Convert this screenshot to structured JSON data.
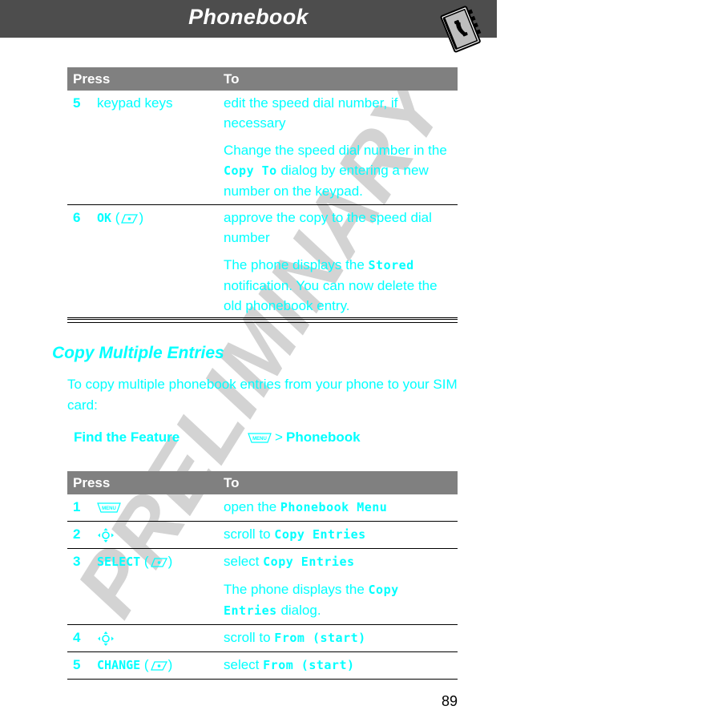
{
  "header": {
    "title": "Phonebook",
    "icon": "phonebook-icon"
  },
  "watermark": "PRELIMINARY",
  "table1": {
    "headers": {
      "press": "Press",
      "to": "To"
    },
    "rows": [
      {
        "num": "5",
        "press": "keypad keys",
        "to": [
          {
            "text": "edit the speed dial number, if necessary"
          },
          {
            "parts": [
              {
                "t": "Change the speed dial number in the ",
                "k": false
              },
              {
                "t": "Copy To",
                "k": true
              },
              {
                "t": " dialog by entering a new number on the keypad.",
                "k": false
              }
            ]
          }
        ]
      },
      {
        "num": "6",
        "press_key": "OK",
        "press_icon": "soft-key-icon",
        "to": [
          {
            "text": "approve the copy to the speed dial number"
          },
          {
            "parts": [
              {
                "t": "The phone displays the ",
                "k": false
              },
              {
                "t": "Stored",
                "k": true
              },
              {
                "t": " notification. You can now delete the old phonebook entry.",
                "k": false
              }
            ]
          }
        ]
      }
    ]
  },
  "section": {
    "title": "Copy Multiple Entries",
    "intro": "To copy multiple phonebook entries from your phone to your SIM card:",
    "find_feature": {
      "label": "Find the Feature",
      "icon": "menu-key-icon",
      "separator": ">",
      "path": "Phonebook"
    }
  },
  "table2": {
    "headers": {
      "press": "Press",
      "to": "To"
    },
    "rows": [
      {
        "num": "1",
        "press_icon": "menu-key-icon",
        "to_prefix": "open the ",
        "to_key": "Phonebook Menu"
      },
      {
        "num": "2",
        "press_icon": "nav-key-icon",
        "to_prefix": "scroll to ",
        "to_key": "Copy Entries"
      },
      {
        "num": "3",
        "press_key": "SELECT",
        "press_icon": "soft-key-icon",
        "to_prefix": "select ",
        "to_key": "Copy Entries",
        "note_prefix": "The phone displays the ",
        "note_key": "Copy Entries",
        "note_suffix": " dialog."
      },
      {
        "num": "4",
        "press_icon": "nav-key-icon",
        "to_prefix": "scroll to ",
        "to_key": "From (start)"
      },
      {
        "num": "5",
        "press_key": "CHANGE",
        "press_icon": "soft-key-icon",
        "to_prefix": "select ",
        "to_key": "From (start)"
      }
    ]
  },
  "page_number": "89",
  "colors": {
    "text": "#00ffff",
    "header_bar": "#4d4d4d",
    "table_header": "#808080",
    "watermark": "#d3d3d3"
  }
}
